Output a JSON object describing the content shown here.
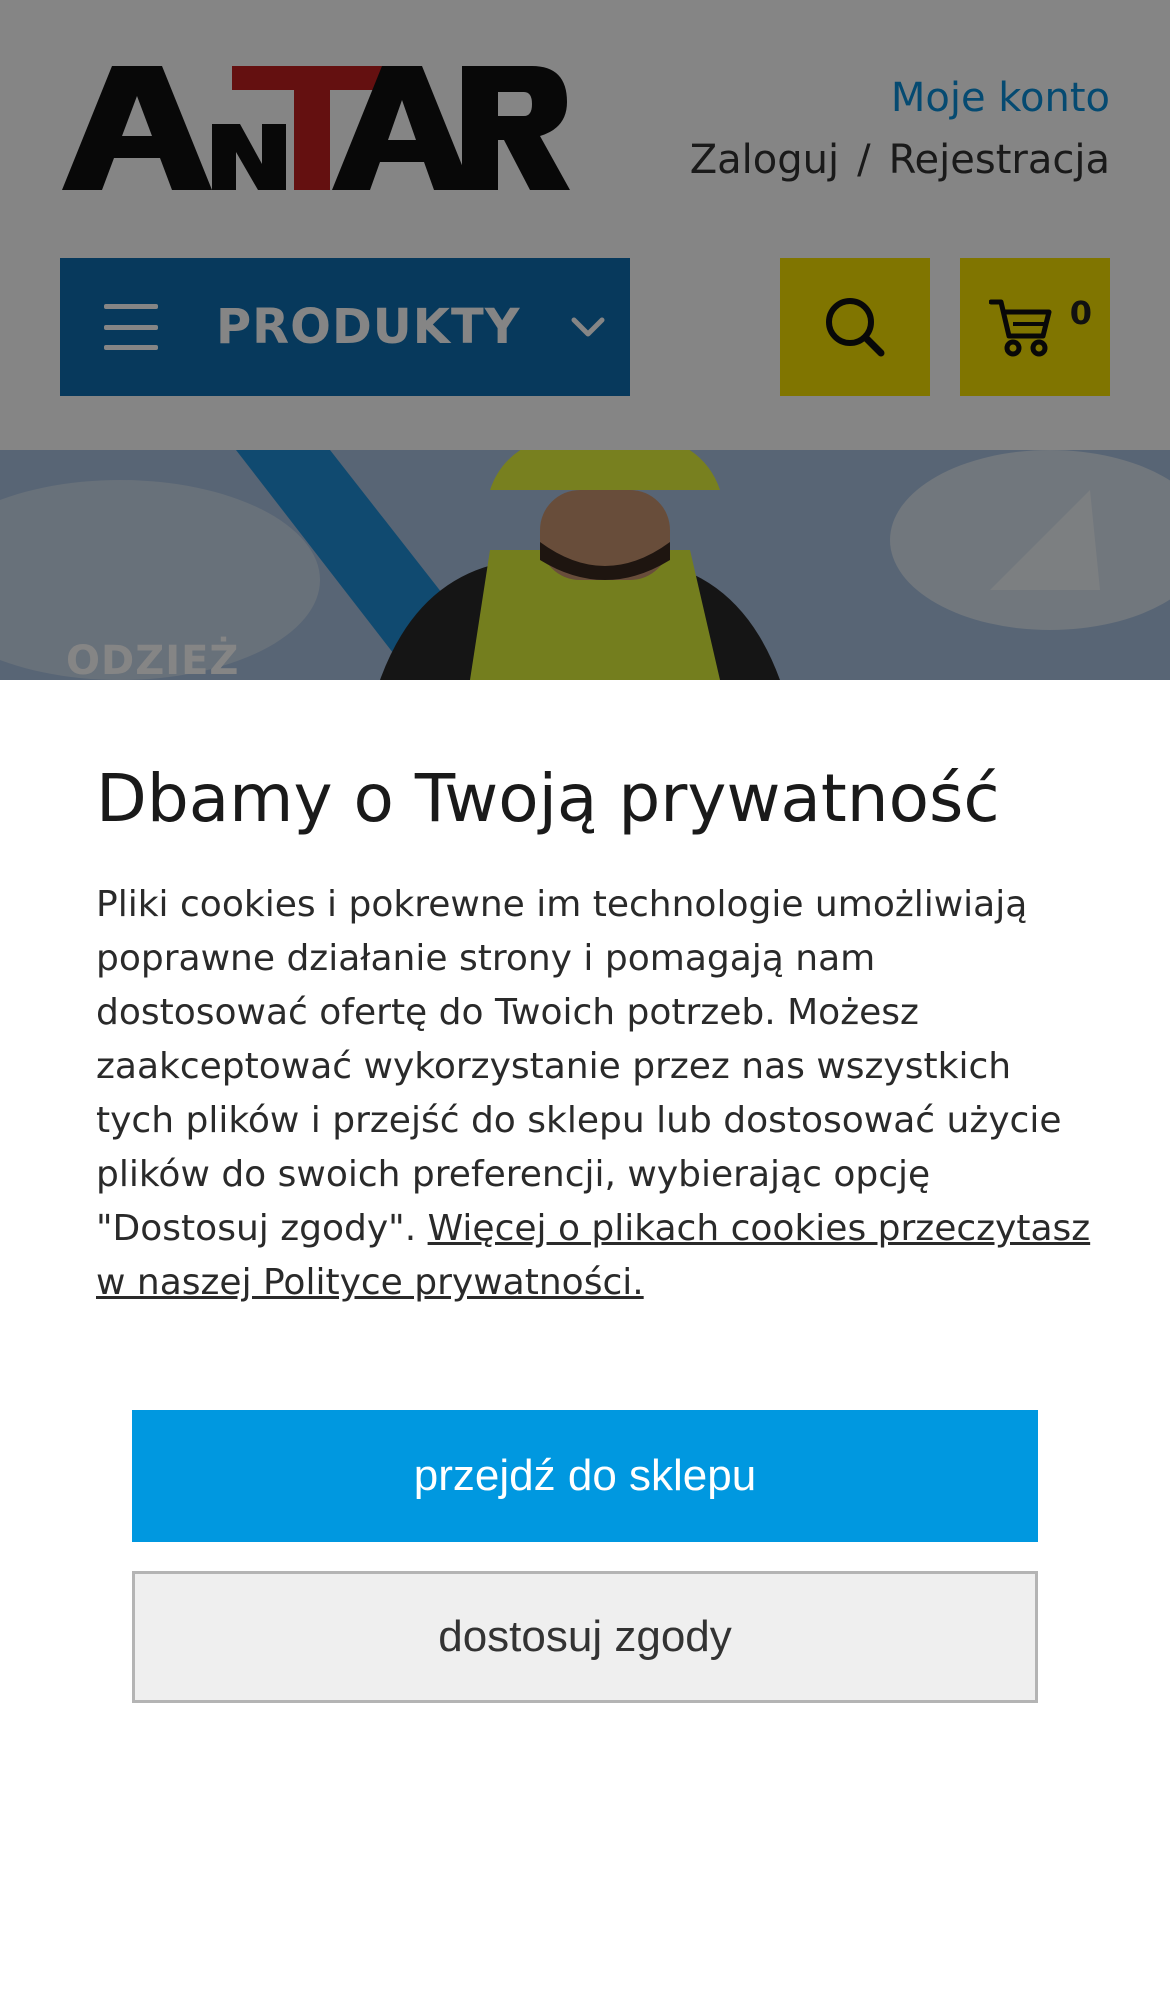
{
  "header": {
    "logo_text": "ANTAR",
    "account_title": "Moje konto",
    "login_label": "Zaloguj",
    "separator": "/",
    "register_label": "Rejestracja",
    "products_label": "PRODUKTY",
    "cart_count": "0"
  },
  "hero": {
    "label": "ODZIEŻ"
  },
  "cookie": {
    "title": "Dbamy o Twoją prywatność",
    "text": "Pliki cookies i pokrewne im technologie umożliwiają poprawne działanie strony i pomagają nam dostosować ofertę do Twoich potrzeb. Możesz zaakceptować wykorzystanie przez nas wszystkich tych plików i przejść do sklepu lub dostosować użycie plików do swoich preferencji, wybierając opcję \"Dostosuj zgody\".",
    "link_text": "Więcej o plikach cookies przeczytasz w naszej Polityce prywatności.",
    "accept_label": "przejdź do sklepu",
    "customize_label": "dostosuj zgody"
  },
  "colors": {
    "brand_blue": "#0e6eb0",
    "accent_yellow": "#f5e100",
    "primary_button": "#0098e0",
    "logo_red": "#c01f1f"
  }
}
